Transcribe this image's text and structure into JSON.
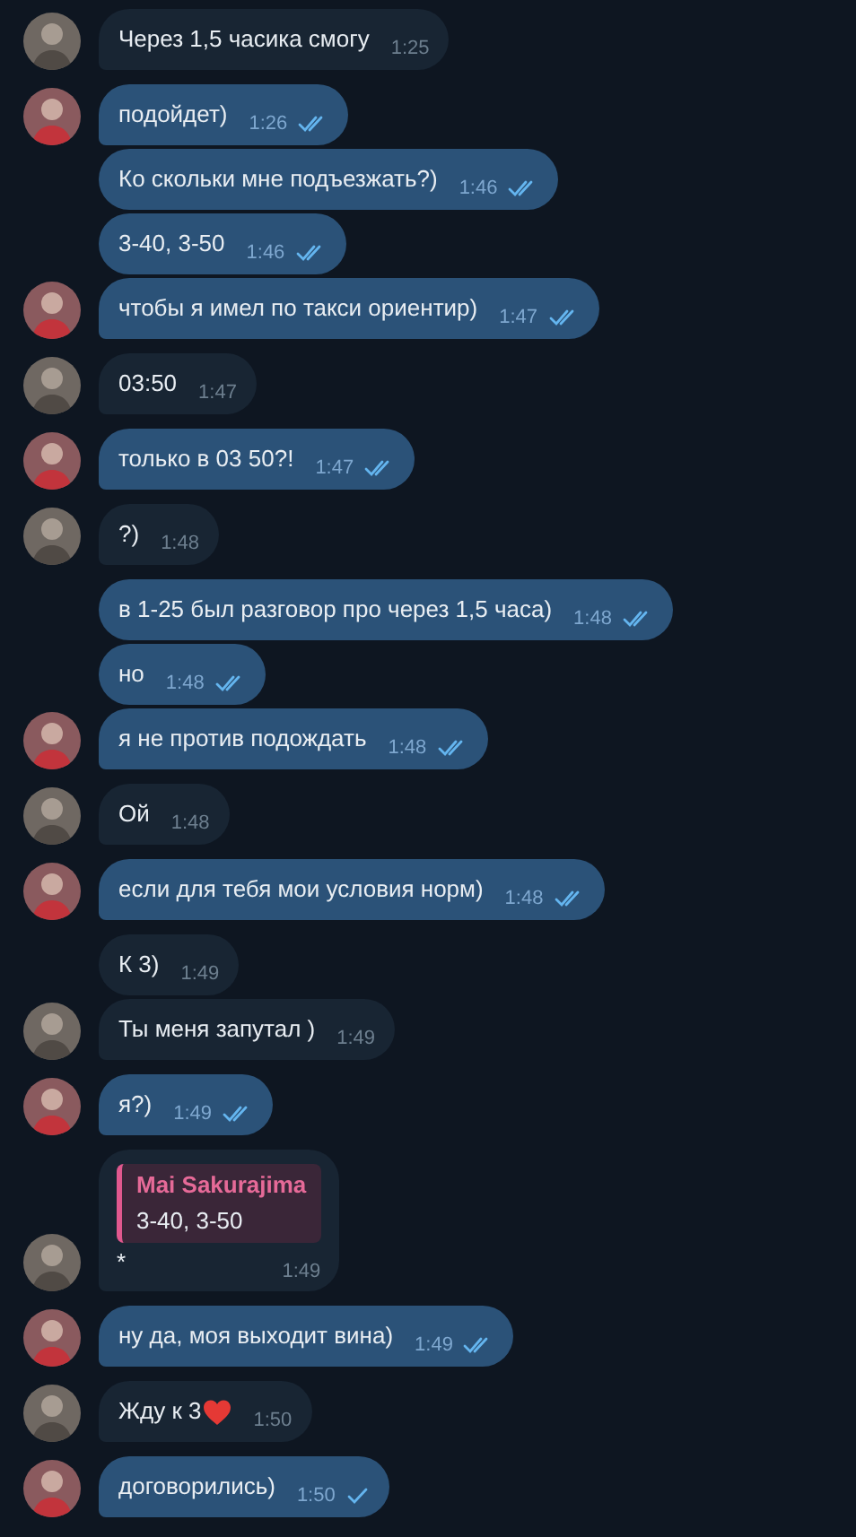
{
  "messages": [
    {
      "kind": "in",
      "text": "Через 1,5 часика смогу",
      "time": "1:25",
      "avatar": true
    },
    {
      "kind": "out",
      "text": "подойдет)",
      "time": "1:26",
      "read": true,
      "avatar": true
    },
    {
      "kind": "out",
      "text": "Ко скольки мне подъезжать?)",
      "time": "1:46",
      "read": true,
      "avatar": false
    },
    {
      "kind": "out",
      "text": "3-40, 3-50",
      "time": "1:46",
      "read": true,
      "avatar": false
    },
    {
      "kind": "out",
      "text": "чтобы я имел по такси ориентир)",
      "time": "1:47",
      "read": true,
      "avatar": true
    },
    {
      "kind": "in",
      "text": "03:50",
      "time": "1:47",
      "avatar": true
    },
    {
      "kind": "out",
      "text": "только в 03 50?!",
      "time": "1:47",
      "read": true,
      "avatar": true
    },
    {
      "kind": "in",
      "text": "?)",
      "time": "1:48",
      "avatar": true
    },
    {
      "kind": "out",
      "text": "в 1-25 был разговор про через 1,5 часа)",
      "time": "1:48",
      "read": true,
      "avatar": false
    },
    {
      "kind": "out",
      "text": "но",
      "time": "1:48",
      "read": true,
      "avatar": false
    },
    {
      "kind": "out",
      "text": "я не против подождать",
      "time": "1:48",
      "read": true,
      "avatar": true
    },
    {
      "kind": "in",
      "text": "Ой",
      "time": "1:48",
      "avatar": true
    },
    {
      "kind": "out",
      "text": "если для тебя мои условия норм)",
      "time": "1:48",
      "read": true,
      "avatar": true
    },
    {
      "kind": "in",
      "text": "К 3)",
      "time": "1:49",
      "avatar": false
    },
    {
      "kind": "in",
      "text": "Ты меня запутал )",
      "time": "1:49",
      "avatar": true
    },
    {
      "kind": "out",
      "text": "я?)",
      "time": "1:49",
      "read": true,
      "avatar": true
    },
    {
      "kind": "in",
      "reply": {
        "name": "Mai Sakurajima",
        "text": "3-40, 3-50"
      },
      "text": "*",
      "time": "1:49",
      "avatar": true
    },
    {
      "kind": "out",
      "text": "ну да, моя выходит вина)",
      "time": "1:49",
      "read": true,
      "avatar": true
    },
    {
      "kind": "in",
      "text": "Жду к 3",
      "heart": true,
      "time": "1:50",
      "avatar": true
    },
    {
      "kind": "out",
      "text": "договорились)",
      "time": "1:50",
      "read": false,
      "avatar": true
    }
  ]
}
